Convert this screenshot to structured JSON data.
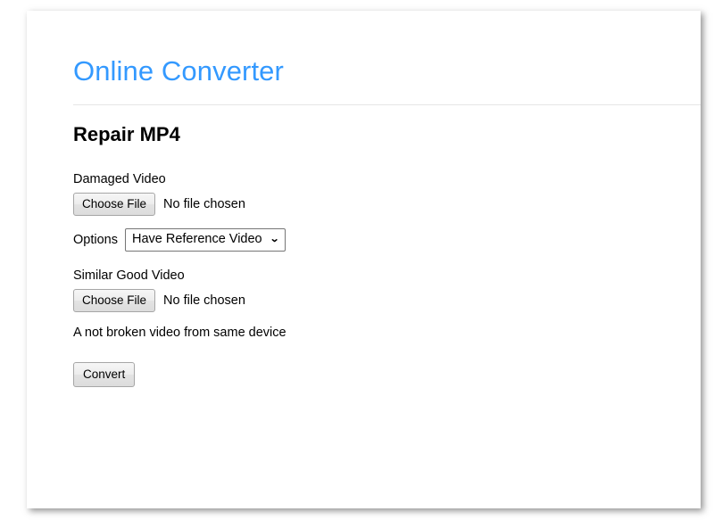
{
  "header": {
    "site_title": "Online Converter"
  },
  "main": {
    "heading": "Repair MP4",
    "damaged_video": {
      "label": "Damaged Video",
      "choose_file_label": "Choose File",
      "file_status": "No file chosen"
    },
    "options": {
      "label": "Options",
      "selected": "Have Reference Video",
      "chevron": "❯"
    },
    "similar_video": {
      "label": "Similar Good Video",
      "choose_file_label": "Choose File",
      "file_status": "No file chosen",
      "help_text": "A not broken video from same device"
    },
    "submit_label": "Convert"
  },
  "colors": {
    "brand_blue": "#3399ff",
    "text": "#000000",
    "rule": "#e6e6e6",
    "button_border": "#a6a6a6",
    "select_border": "#767676"
  }
}
